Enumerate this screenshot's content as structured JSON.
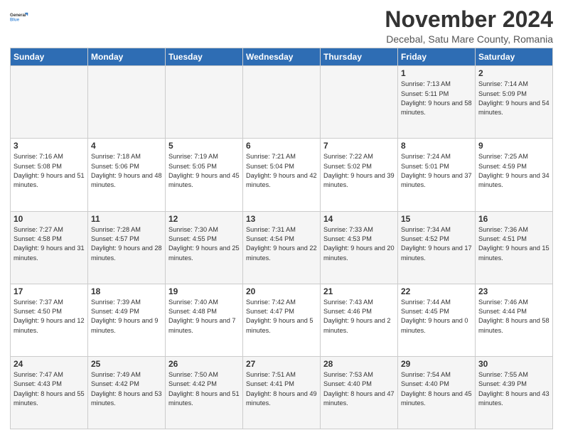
{
  "logo": {
    "line1": "General",
    "line2": "Blue"
  },
  "title": "November 2024",
  "subtitle": "Decebal, Satu Mare County, Romania",
  "days_of_week": [
    "Sunday",
    "Monday",
    "Tuesday",
    "Wednesday",
    "Thursday",
    "Friday",
    "Saturday"
  ],
  "weeks": [
    [
      {
        "day": "",
        "info": ""
      },
      {
        "day": "",
        "info": ""
      },
      {
        "day": "",
        "info": ""
      },
      {
        "day": "",
        "info": ""
      },
      {
        "day": "",
        "info": ""
      },
      {
        "day": "1",
        "info": "Sunrise: 7:13 AM\nSunset: 5:11 PM\nDaylight: 9 hours and 58 minutes."
      },
      {
        "day": "2",
        "info": "Sunrise: 7:14 AM\nSunset: 5:09 PM\nDaylight: 9 hours and 54 minutes."
      }
    ],
    [
      {
        "day": "3",
        "info": "Sunrise: 7:16 AM\nSunset: 5:08 PM\nDaylight: 9 hours and 51 minutes."
      },
      {
        "day": "4",
        "info": "Sunrise: 7:18 AM\nSunset: 5:06 PM\nDaylight: 9 hours and 48 minutes."
      },
      {
        "day": "5",
        "info": "Sunrise: 7:19 AM\nSunset: 5:05 PM\nDaylight: 9 hours and 45 minutes."
      },
      {
        "day": "6",
        "info": "Sunrise: 7:21 AM\nSunset: 5:04 PM\nDaylight: 9 hours and 42 minutes."
      },
      {
        "day": "7",
        "info": "Sunrise: 7:22 AM\nSunset: 5:02 PM\nDaylight: 9 hours and 39 minutes."
      },
      {
        "day": "8",
        "info": "Sunrise: 7:24 AM\nSunset: 5:01 PM\nDaylight: 9 hours and 37 minutes."
      },
      {
        "day": "9",
        "info": "Sunrise: 7:25 AM\nSunset: 4:59 PM\nDaylight: 9 hours and 34 minutes."
      }
    ],
    [
      {
        "day": "10",
        "info": "Sunrise: 7:27 AM\nSunset: 4:58 PM\nDaylight: 9 hours and 31 minutes."
      },
      {
        "day": "11",
        "info": "Sunrise: 7:28 AM\nSunset: 4:57 PM\nDaylight: 9 hours and 28 minutes."
      },
      {
        "day": "12",
        "info": "Sunrise: 7:30 AM\nSunset: 4:55 PM\nDaylight: 9 hours and 25 minutes."
      },
      {
        "day": "13",
        "info": "Sunrise: 7:31 AM\nSunset: 4:54 PM\nDaylight: 9 hours and 22 minutes."
      },
      {
        "day": "14",
        "info": "Sunrise: 7:33 AM\nSunset: 4:53 PM\nDaylight: 9 hours and 20 minutes."
      },
      {
        "day": "15",
        "info": "Sunrise: 7:34 AM\nSunset: 4:52 PM\nDaylight: 9 hours and 17 minutes."
      },
      {
        "day": "16",
        "info": "Sunrise: 7:36 AM\nSunset: 4:51 PM\nDaylight: 9 hours and 15 minutes."
      }
    ],
    [
      {
        "day": "17",
        "info": "Sunrise: 7:37 AM\nSunset: 4:50 PM\nDaylight: 9 hours and 12 minutes."
      },
      {
        "day": "18",
        "info": "Sunrise: 7:39 AM\nSunset: 4:49 PM\nDaylight: 9 hours and 9 minutes."
      },
      {
        "day": "19",
        "info": "Sunrise: 7:40 AM\nSunset: 4:48 PM\nDaylight: 9 hours and 7 minutes."
      },
      {
        "day": "20",
        "info": "Sunrise: 7:42 AM\nSunset: 4:47 PM\nDaylight: 9 hours and 5 minutes."
      },
      {
        "day": "21",
        "info": "Sunrise: 7:43 AM\nSunset: 4:46 PM\nDaylight: 9 hours and 2 minutes."
      },
      {
        "day": "22",
        "info": "Sunrise: 7:44 AM\nSunset: 4:45 PM\nDaylight: 9 hours and 0 minutes."
      },
      {
        "day": "23",
        "info": "Sunrise: 7:46 AM\nSunset: 4:44 PM\nDaylight: 8 hours and 58 minutes."
      }
    ],
    [
      {
        "day": "24",
        "info": "Sunrise: 7:47 AM\nSunset: 4:43 PM\nDaylight: 8 hours and 55 minutes."
      },
      {
        "day": "25",
        "info": "Sunrise: 7:49 AM\nSunset: 4:42 PM\nDaylight: 8 hours and 53 minutes."
      },
      {
        "day": "26",
        "info": "Sunrise: 7:50 AM\nSunset: 4:42 PM\nDaylight: 8 hours and 51 minutes."
      },
      {
        "day": "27",
        "info": "Sunrise: 7:51 AM\nSunset: 4:41 PM\nDaylight: 8 hours and 49 minutes."
      },
      {
        "day": "28",
        "info": "Sunrise: 7:53 AM\nSunset: 4:40 PM\nDaylight: 8 hours and 47 minutes."
      },
      {
        "day": "29",
        "info": "Sunrise: 7:54 AM\nSunset: 4:40 PM\nDaylight: 8 hours and 45 minutes."
      },
      {
        "day": "30",
        "info": "Sunrise: 7:55 AM\nSunset: 4:39 PM\nDaylight: 8 hours and 43 minutes."
      }
    ]
  ]
}
